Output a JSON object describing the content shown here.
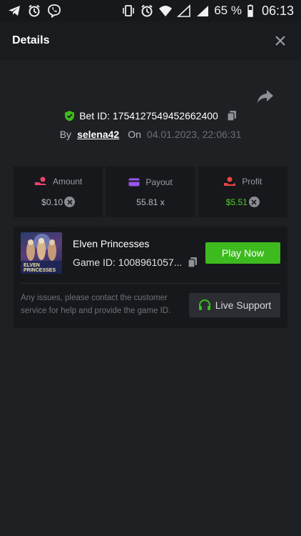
{
  "status_bar": {
    "battery": "65 %",
    "time": "06:13"
  },
  "header": {
    "title": "Details"
  },
  "bet": {
    "id_text": "Bet ID: 1754127549452662400",
    "by_label": "By",
    "username": "selena42",
    "on_label": "On",
    "date": "04.01.2023, 22:06:31"
  },
  "stats": [
    {
      "label": "Amount",
      "value": "$0.10",
      "icon": "coins-hand-icon",
      "color": "#e8456a"
    },
    {
      "label": "Payout",
      "value": "55.81 x",
      "icon": "card-icon",
      "color": "#9a55f0"
    },
    {
      "label": "Profit",
      "value": "$5.51",
      "icon": "money-hand-icon",
      "color": "#e84545"
    }
  ],
  "game": {
    "name": "Elven Princesses",
    "id_text": "Game ID: 1008961057...",
    "play_label": "Play Now",
    "support_text": "Any issues, please contact the customer service for help and provide the game ID.",
    "live_support_label": "Live Support",
    "thumb_title_line1": "ELVEN",
    "thumb_title_line2": "PRINCESSES"
  },
  "colors": {
    "accent_green": "#3dbb1e",
    "profit_green": "#4fd12a",
    "background": "#1f2024"
  }
}
